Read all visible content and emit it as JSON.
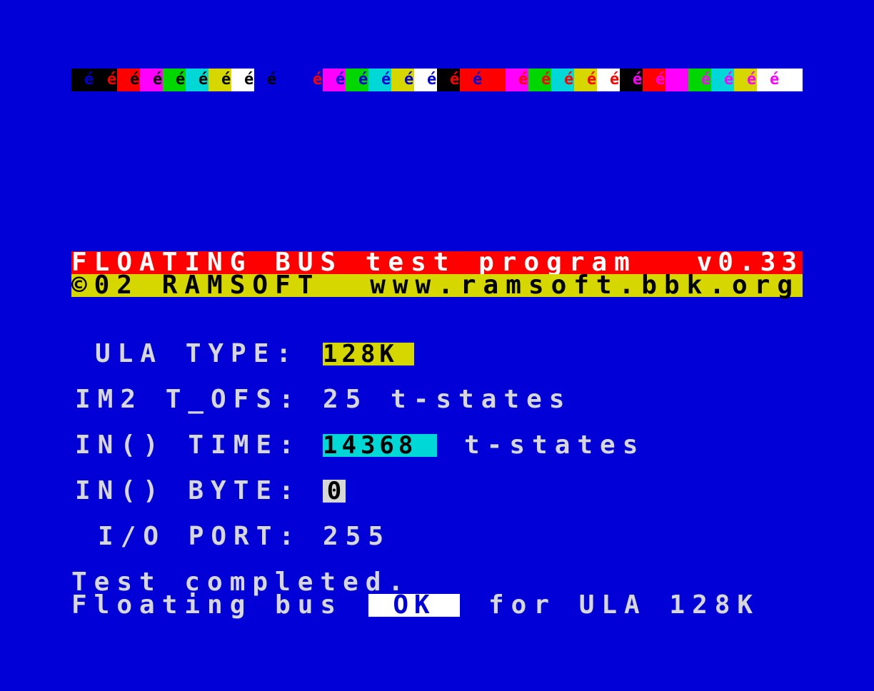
{
  "colors": {
    "background": "#0000D7",
    "title_bg": "#FF0000",
    "copyright_bg": "#D7D700",
    "ink": "#D7D7D7",
    "ok_bg": "#FFFFFF"
  },
  "attribute_strip": {
    "glyph": "é",
    "cells": [
      {
        "paper": "#000000",
        "ink": "#0000D7"
      },
      {
        "paper": "#000000",
        "ink": "#FF0000"
      },
      {
        "paper": "#FF0000",
        "ink": "#000000"
      },
      {
        "paper": "#FF00FF",
        "ink": "#000000"
      },
      {
        "paper": "#00D700",
        "ink": "#000000"
      },
      {
        "paper": "#00D7D7",
        "ink": "#000000"
      },
      {
        "paper": "#D7D700",
        "ink": "#000000"
      },
      {
        "paper": "#FFFFFF",
        "ink": "#000000"
      },
      {
        "paper": "#0000D7",
        "ink": "#000000"
      },
      {
        "paper": "#0000D7",
        "ink": "#0000D7"
      },
      {
        "paper": "#0000D7",
        "ink": "#FF0000"
      },
      {
        "paper": "#FF00FF",
        "ink": "#0000D7"
      },
      {
        "paper": "#00D700",
        "ink": "#0000D7"
      },
      {
        "paper": "#00D7D7",
        "ink": "#0000D7"
      },
      {
        "paper": "#D7D700",
        "ink": "#0000D7"
      },
      {
        "paper": "#FFFFFF",
        "ink": "#0000D7"
      },
      {
        "paper": "#000000",
        "ink": "#FF0000"
      },
      {
        "paper": "#FF0000",
        "ink": "#0000D7"
      },
      {
        "paper": "#FF0000",
        "ink": "#FF0000"
      },
      {
        "paper": "#FF00FF",
        "ink": "#FF0000"
      },
      {
        "paper": "#00D700",
        "ink": "#FF0000"
      },
      {
        "paper": "#00D7D7",
        "ink": "#FF0000"
      },
      {
        "paper": "#D7D700",
        "ink": "#FF0000"
      },
      {
        "paper": "#FFFFFF",
        "ink": "#FF0000"
      },
      {
        "paper": "#000000",
        "ink": "#FF00FF"
      },
      {
        "paper": "#FF0000",
        "ink": "#FF00FF"
      },
      {
        "paper": "#FF00FF",
        "ink": "#FF00FF"
      },
      {
        "paper": "#00D700",
        "ink": "#FF00FF"
      },
      {
        "paper": "#00D7D7",
        "ink": "#FF00FF"
      },
      {
        "paper": "#D7D700",
        "ink": "#FF00FF"
      },
      {
        "paper": "#FFFFFF",
        "ink": "#FF00FF"
      },
      {
        "paper": "#FFFFFF",
        "ink": "#FFFFFF"
      }
    ]
  },
  "header": {
    "title": "FLOATING BUS test program",
    "version": "v0.33",
    "copyright": "©02 RAMSOFT",
    "url": "www.ramsoft.bbk.org"
  },
  "info": {
    "ula_type_label": "ULA TYPE:",
    "ula_type_value": "128K",
    "im2_label": "IM2 T_OFS:",
    "im2_value": "25 t-states",
    "in_time_label": "IN() TIME:",
    "in_time_value": "14368",
    "in_time_unit": "t-states",
    "in_byte_label": "IN() BYTE:",
    "in_byte_value": "0",
    "io_port_label": "I/O PORT:",
    "io_port_value": "255"
  },
  "status": {
    "line1": "Test completed.",
    "line2_prefix": "Floating bus",
    "result": "OK",
    "line2_suffix": "for ULA 128K"
  }
}
